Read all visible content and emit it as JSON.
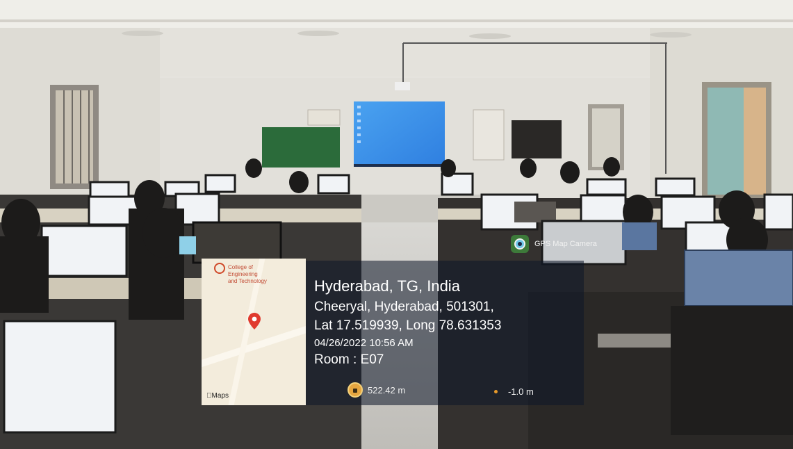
{
  "overlay": {
    "app_name": "GPS Map Camera",
    "location_title": "Hyderabad, TG, India",
    "address": "Cheeryal, Hyderabad, 501301,",
    "coordinates": "Lat 17.519939, Long 78.631353",
    "datetime": "04/26/2022 10:56 AM",
    "room": "Room : E07",
    "altitude": "522.42 m",
    "reading": "-1.0 m"
  },
  "map": {
    "campus_name": "College of\nEngineering\nand Technology",
    "maps_label": "Maps",
    "pin_color": "#e03a2e"
  },
  "scene": {
    "description_icons": [
      "projector-screen-icon",
      "computer-monitor-icon",
      "ceiling-fan-icon",
      "window-icon"
    ]
  }
}
